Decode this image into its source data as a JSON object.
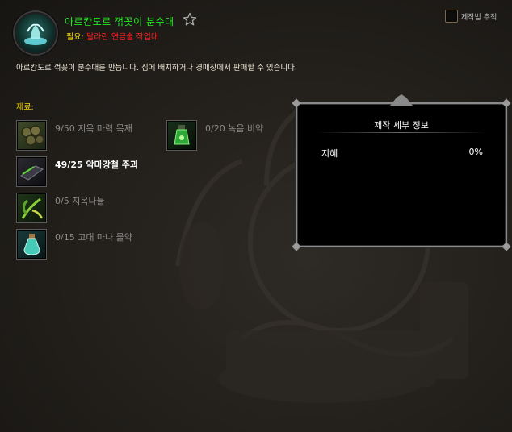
{
  "recipe": {
    "title": "아르칸도르 꺾꽂이 분수대",
    "requires_label": "필요:",
    "requires_value": "달라란 연금술 작업대",
    "description": "아르칸도르 꺾꽂이 분수대를 만듭니다. 집에 배치하거나 경매장에서 판매할 수 있습니다.",
    "favorite_icon": "star-outline-icon",
    "recipe_icon": "fountain-icon"
  },
  "track": {
    "label": "제작법 추적",
    "checked": false
  },
  "reagents": {
    "title": "재료:",
    "items": [
      {
        "label": "9/50 지옥 마력 목재",
        "icon": "logs-icon",
        "sufficient": false
      },
      {
        "label": "49/25 악마강철 주괴",
        "icon": "ingot-icon",
        "sufficient": true
      },
      {
        "label": "0/5 지옥나물",
        "icon": "herb-icon",
        "sufficient": false
      },
      {
        "label": "0/15 고대 마나 물약",
        "icon": "potion-icon",
        "sufficient": false
      },
      {
        "label": "0/20 녹음 비약",
        "icon": "green-elixir-icon",
        "sufficient": false
      }
    ]
  },
  "details_panel": {
    "title": "제작 세부 정보",
    "stat_name": "지혜",
    "stat_value": "0%"
  },
  "colors": {
    "title_green": "#22ee22",
    "label_yellow": "#f2d100",
    "requirement_red": "#ff2020",
    "missing_gray": "#8a8a8a"
  }
}
